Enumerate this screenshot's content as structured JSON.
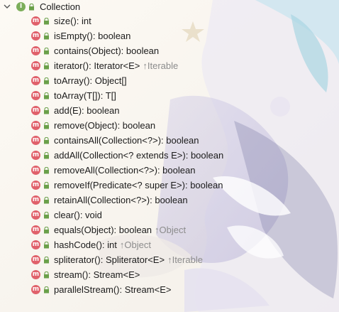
{
  "colors": {
    "interface_icon": "#7cae5a",
    "method_icon": "#e0616b",
    "lock_icon": "#6aa04a",
    "text": "#1b1b1b",
    "inherited_text": "#8c8c8c"
  },
  "tree": {
    "root": {
      "icon_letter": "I",
      "label": "Collection"
    },
    "method_icon_letter": "m",
    "methods": [
      {
        "signature": "size(): int",
        "origin": ""
      },
      {
        "signature": "isEmpty(): boolean",
        "origin": ""
      },
      {
        "signature": "contains(Object): boolean",
        "origin": ""
      },
      {
        "signature": "iterator(): Iterator<E>",
        "origin": "↑Iterable"
      },
      {
        "signature": "toArray(): Object[]",
        "origin": ""
      },
      {
        "signature": "toArray(T[]): T[]",
        "origin": ""
      },
      {
        "signature": "add(E): boolean",
        "origin": ""
      },
      {
        "signature": "remove(Object): boolean",
        "origin": ""
      },
      {
        "signature": "containsAll(Collection<?>): boolean",
        "origin": ""
      },
      {
        "signature": "addAll(Collection<? extends E>): boolean",
        "origin": ""
      },
      {
        "signature": "removeAll(Collection<?>): boolean",
        "origin": ""
      },
      {
        "signature": "removeIf(Predicate<? super E>): boolean",
        "origin": ""
      },
      {
        "signature": "retainAll(Collection<?>): boolean",
        "origin": ""
      },
      {
        "signature": "clear(): void",
        "origin": ""
      },
      {
        "signature": "equals(Object): boolean",
        "origin": "↑Object"
      },
      {
        "signature": "hashCode(): int",
        "origin": "↑Object"
      },
      {
        "signature": "spliterator(): Spliterator<E>",
        "origin": "↑Iterable"
      },
      {
        "signature": "stream(): Stream<E>",
        "origin": ""
      },
      {
        "signature": "parallelStream(): Stream<E>",
        "origin": ""
      }
    ]
  }
}
